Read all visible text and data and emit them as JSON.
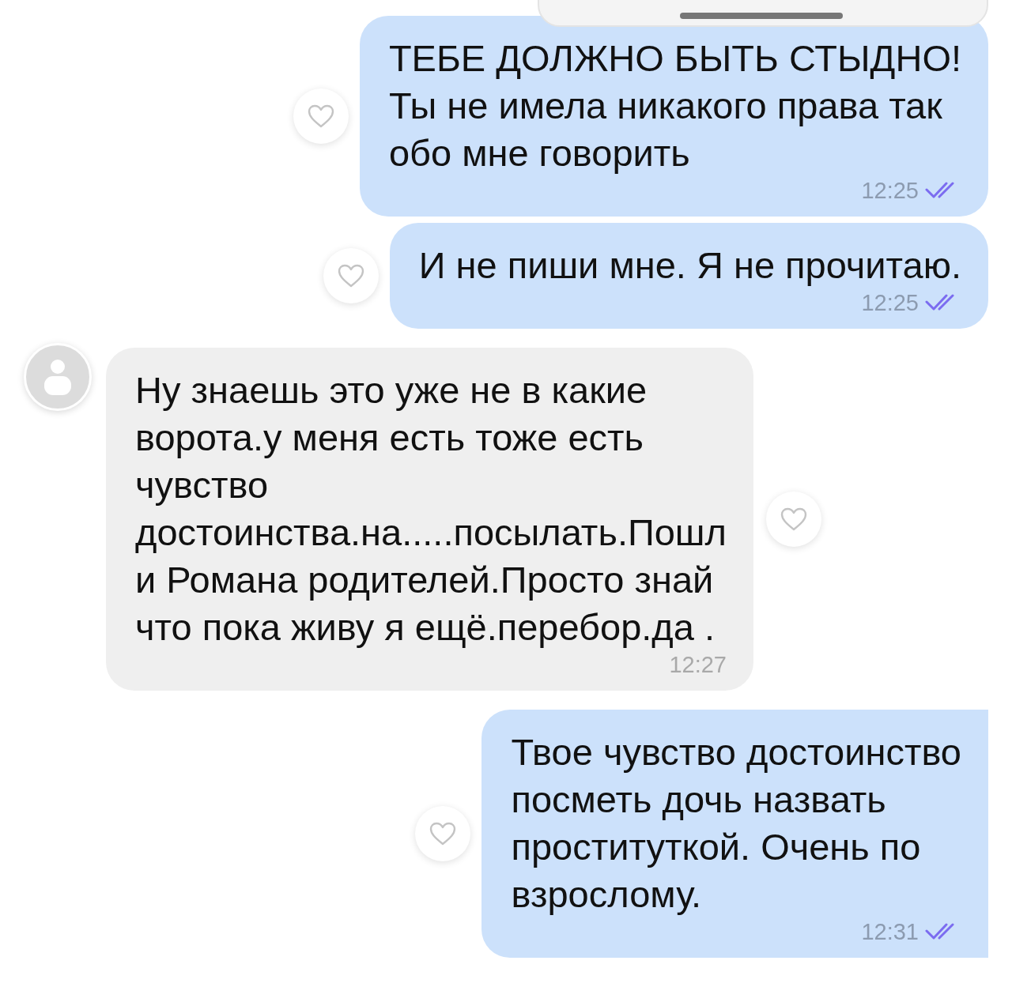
{
  "messages": [
    {
      "kind": "outgoing",
      "lines": [
        "ТЕБЕ ДОЛЖНО БЫТЬ СТЫДНО!",
        "Ты не имела никакого права так",
        "обо мне говорить"
      ],
      "time": "12:25",
      "read": true,
      "liked": false
    },
    {
      "kind": "outgoing",
      "lines": [
        "И не пиши мне. Я не прочитаю."
      ],
      "time": "12:25",
      "read": true,
      "liked": false
    },
    {
      "kind": "incoming",
      "lines": [
        "Ну знаешь это уже не в какие",
        "ворота.у меня есть тоже есть",
        "чувство",
        "достоинства.на.....посылать.Пошл",
        "и Романа родителей.Просто знай",
        "что пока живу я ещё.перебор.да ."
      ],
      "time": "12:27",
      "liked": false
    },
    {
      "kind": "outgoing",
      "lines": [
        "Твое чувство достоинство",
        "посметь дочь назвать",
        "проституткой. Очень по",
        "взрослому."
      ],
      "time": "12:31",
      "read": true,
      "liked": false
    }
  ]
}
